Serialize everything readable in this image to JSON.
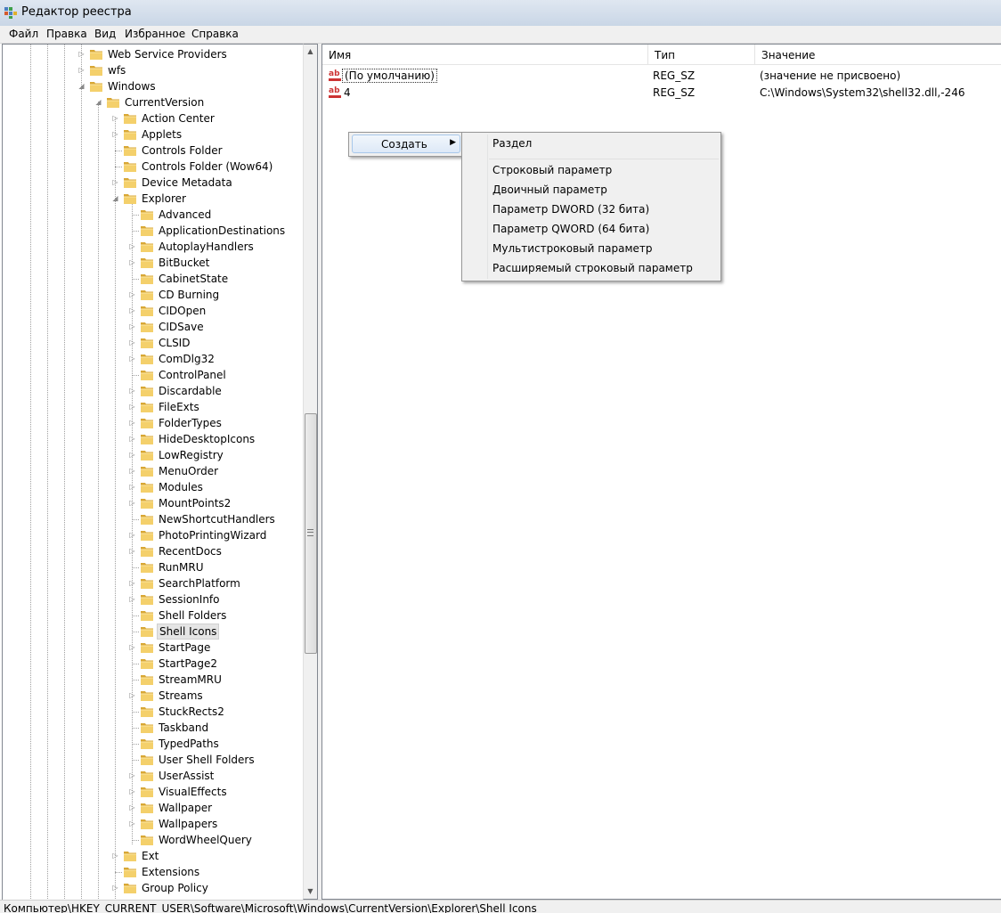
{
  "window": {
    "title": "Редактор реестра"
  },
  "menu": [
    "Файл",
    "Правка",
    "Вид",
    "Избранное",
    "Справка"
  ],
  "tree": [
    {
      "label": "Web Service Providers",
      "level": 0,
      "arrow": "collapsed"
    },
    {
      "label": "wfs",
      "level": 0,
      "arrow": "collapsed"
    },
    {
      "label": "Windows",
      "level": 0,
      "arrow": "expanded"
    },
    {
      "label": "CurrentVersion",
      "level": 1,
      "arrow": "expanded"
    },
    {
      "label": "Action Center",
      "level": 2,
      "arrow": "collapsed"
    },
    {
      "label": "Applets",
      "level": 2,
      "arrow": "collapsed"
    },
    {
      "label": "Controls Folder",
      "level": 2,
      "arrow": "none"
    },
    {
      "label": "Controls Folder (Wow64)",
      "level": 2,
      "arrow": "none"
    },
    {
      "label": "Device Metadata",
      "level": 2,
      "arrow": "collapsed"
    },
    {
      "label": "Explorer",
      "level": 2,
      "arrow": "expanded"
    },
    {
      "label": "Advanced",
      "level": 3,
      "arrow": "none"
    },
    {
      "label": "ApplicationDestinations",
      "level": 3,
      "arrow": "none"
    },
    {
      "label": "AutoplayHandlers",
      "level": 3,
      "arrow": "collapsed"
    },
    {
      "label": "BitBucket",
      "level": 3,
      "arrow": "collapsed"
    },
    {
      "label": "CabinetState",
      "level": 3,
      "arrow": "none"
    },
    {
      "label": "CD Burning",
      "level": 3,
      "arrow": "collapsed"
    },
    {
      "label": "CIDOpen",
      "level": 3,
      "arrow": "collapsed"
    },
    {
      "label": "CIDSave",
      "level": 3,
      "arrow": "collapsed"
    },
    {
      "label": "CLSID",
      "level": 3,
      "arrow": "collapsed"
    },
    {
      "label": "ComDlg32",
      "level": 3,
      "arrow": "collapsed"
    },
    {
      "label": "ControlPanel",
      "level": 3,
      "arrow": "none"
    },
    {
      "label": "Discardable",
      "level": 3,
      "arrow": "collapsed"
    },
    {
      "label": "FileExts",
      "level": 3,
      "arrow": "collapsed"
    },
    {
      "label": "FolderTypes",
      "level": 3,
      "arrow": "collapsed"
    },
    {
      "label": "HideDesktopIcons",
      "level": 3,
      "arrow": "collapsed"
    },
    {
      "label": "LowRegistry",
      "level": 3,
      "arrow": "collapsed"
    },
    {
      "label": "MenuOrder",
      "level": 3,
      "arrow": "collapsed"
    },
    {
      "label": "Modules",
      "level": 3,
      "arrow": "collapsed"
    },
    {
      "label": "MountPoints2",
      "level": 3,
      "arrow": "collapsed"
    },
    {
      "label": "NewShortcutHandlers",
      "level": 3,
      "arrow": "none"
    },
    {
      "label": "PhotoPrintingWizard",
      "level": 3,
      "arrow": "collapsed"
    },
    {
      "label": "RecentDocs",
      "level": 3,
      "arrow": "collapsed"
    },
    {
      "label": "RunMRU",
      "level": 3,
      "arrow": "none"
    },
    {
      "label": "SearchPlatform",
      "level": 3,
      "arrow": "collapsed"
    },
    {
      "label": "SessionInfo",
      "level": 3,
      "arrow": "collapsed"
    },
    {
      "label": "Shell Folders",
      "level": 3,
      "arrow": "none"
    },
    {
      "label": "Shell Icons",
      "level": 3,
      "arrow": "none",
      "selected": true
    },
    {
      "label": "StartPage",
      "level": 3,
      "arrow": "collapsed"
    },
    {
      "label": "StartPage2",
      "level": 3,
      "arrow": "none"
    },
    {
      "label": "StreamMRU",
      "level": 3,
      "arrow": "none"
    },
    {
      "label": "Streams",
      "level": 3,
      "arrow": "collapsed"
    },
    {
      "label": "StuckRects2",
      "level": 3,
      "arrow": "none"
    },
    {
      "label": "Taskband",
      "level": 3,
      "arrow": "none"
    },
    {
      "label": "TypedPaths",
      "level": 3,
      "arrow": "none"
    },
    {
      "label": "User Shell Folders",
      "level": 3,
      "arrow": "none"
    },
    {
      "label": "UserAssist",
      "level": 3,
      "arrow": "collapsed"
    },
    {
      "label": "VisualEffects",
      "level": 3,
      "arrow": "collapsed"
    },
    {
      "label": "Wallpaper",
      "level": 3,
      "arrow": "collapsed"
    },
    {
      "label": "Wallpapers",
      "level": 3,
      "arrow": "collapsed"
    },
    {
      "label": "WordWheelQuery",
      "level": 3,
      "arrow": "none"
    },
    {
      "label": "Ext",
      "level": 2,
      "arrow": "collapsed"
    },
    {
      "label": "Extensions",
      "level": 2,
      "arrow": "none"
    },
    {
      "label": "Group Policy",
      "level": 2,
      "arrow": "collapsed"
    }
  ],
  "list": {
    "columns": [
      "Имя",
      "Тип",
      "Значение"
    ],
    "rows": [
      {
        "name": "(По умолчанию)",
        "type": "REG_SZ",
        "value": "(значение не присвоено)"
      },
      {
        "name": "4",
        "type": "REG_SZ",
        "value": "C:\\Windows\\System32\\shell32.dll,-246"
      }
    ]
  },
  "context_menu": {
    "create_label": "Создать",
    "submenu": {
      "key_item": "Раздел",
      "items": [
        "Строковый параметр",
        "Двоичный параметр",
        "Параметр DWORD (32 бита)",
        "Параметр QWORD (64 бита)",
        "Мультистроковый параметр",
        "Расширяемый строковый параметр"
      ]
    }
  },
  "status": {
    "path": "Компьютер\\HKEY_CURRENT_USER\\Software\\Microsoft\\Windows\\CurrentVersion\\Explorer\\Shell Icons"
  },
  "colors": {
    "folder": "#f4d06b",
    "folder_dark": "#d8a735",
    "string_icon": "#cc3333"
  }
}
